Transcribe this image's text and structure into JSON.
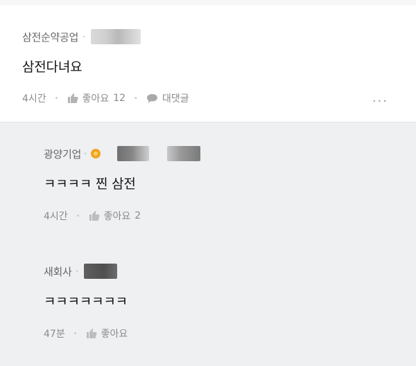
{
  "main_comment": {
    "author": "삼전순약공업",
    "text": "삼전다녀요",
    "time": "4시간",
    "like_label": "좋아요",
    "like_count": "12",
    "reply_label": "대댓글",
    "more_label": "···"
  },
  "replies": [
    {
      "author": "광양기업",
      "text": "ㅋㅋㅋㅋ 찐 삼전",
      "time": "4시간",
      "like_label": "좋아요",
      "like_count": "2"
    },
    {
      "author": "새회사",
      "text": "ㅋㅋㅋㅋㅋㅋㅋ",
      "time": "47분",
      "like_label": "좋아요",
      "like_count": ""
    }
  ],
  "colors": {
    "reply_background": "#eff0f2",
    "badge": "#f4a321"
  }
}
